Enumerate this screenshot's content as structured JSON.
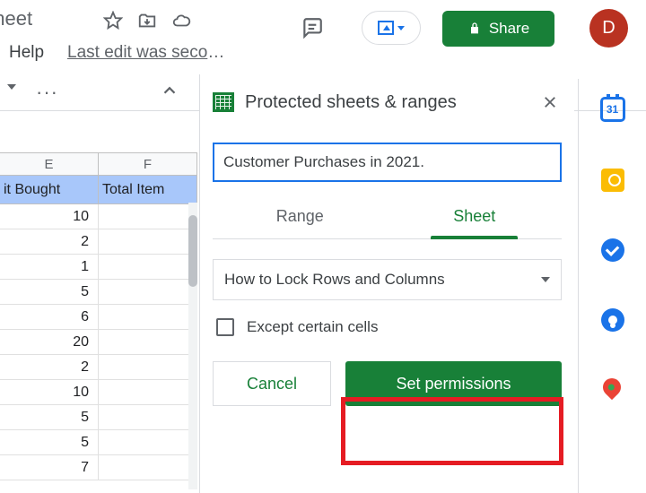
{
  "header": {
    "title_partial": "dsheet",
    "help_label": "Help",
    "last_edit": "Last edit was second…",
    "share_label": "Share",
    "avatar_initial": "D"
  },
  "toolbar": {
    "more": "···"
  },
  "sheet": {
    "cols": [
      "E",
      "F"
    ],
    "header_row": [
      "it Bought",
      "Total Item"
    ],
    "values": [
      "10",
      "2",
      "1",
      "5",
      "6",
      "20",
      "2",
      "10",
      "5",
      "5",
      "7"
    ]
  },
  "panel": {
    "title": "Protected sheets & ranges",
    "description_value": "Customer Purchases in 2021.",
    "tabs": {
      "range": "Range",
      "sheet": "Sheet"
    },
    "dropdown_selected": "How to Lock Rows and Columns",
    "except_label": "Except certain cells",
    "cancel_label": "Cancel",
    "set_permissions_label": "Set permissions"
  },
  "sidebar": {
    "calendar_day": "31"
  }
}
